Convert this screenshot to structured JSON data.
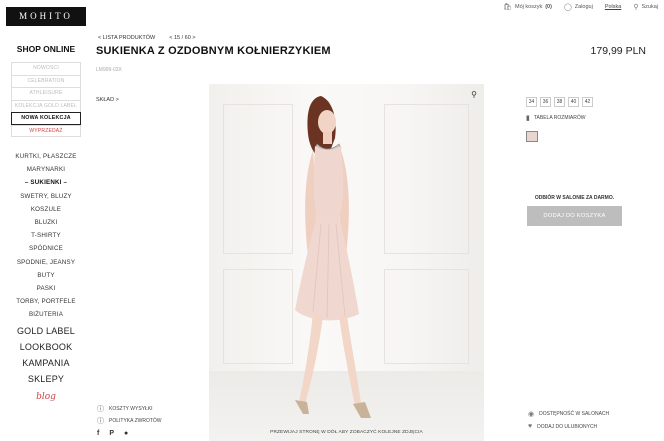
{
  "brand": {
    "logo_text": "MOHITO"
  },
  "topbar": {
    "cart_label": "Mój koszyk",
    "cart_count": "(0)",
    "login_label": "Zaloguj",
    "language": "Polska",
    "search_label": "Szukaj"
  },
  "leftnav": {
    "title": "SHOP ONLINE",
    "box_items": [
      "NOWOSCI",
      "CELEBRATION",
      "ATHLEISURE",
      "KOLEKCJA GOLD LABEL",
      "NOWA KOLEKCJA",
      "WYPRZEDAŻ"
    ],
    "categories": [
      "KURTKI, PŁASZCZE",
      "MARYNARKI",
      "– SUKIENKI –",
      "SWETRY, BLUZY",
      "KOSZULE",
      "BLUZKI",
      "T-SHIRTY",
      "SPÓDNICE",
      "SPODNIE, JEANSY",
      "BUTY",
      "PASKI",
      "TORBY, PORTFELE",
      "BIŻUTERIA"
    ],
    "big_links": [
      "GOLD LABEL",
      "LOOKBOOK",
      "KAMPANIA",
      "SKLEPY"
    ],
    "blog_label": "blog"
  },
  "product": {
    "back_label": "< LISTA PRODUKTÓW",
    "pager": "< 15 / 60 >",
    "title": "SUKIENKA Z OZDOBNYM KOŁNIERZYKIEM",
    "sku": "LM999-03X",
    "price": "179,99 PLN",
    "composition_label": "SKŁAD >",
    "image_caption": "PRZEWIJAJ STRONĘ W DÓŁ ABY ZOBACZYĆ KOLEJNE ZDJĘCIA"
  },
  "options": {
    "sizes": [
      "34",
      "36",
      "38",
      "40",
      "42"
    ],
    "size_chart_label": "TABELA ROZMIARÓW",
    "swatch_color": "#e8d5cf"
  },
  "purchase": {
    "pickup_label": "ODBIÓR W SALONIE ZA DARMO.",
    "add_to_cart_label": "DODAJ DO KOSZYKA",
    "availability_label": "DOSTĘPNOŚĆ W SALONACH",
    "wishlist_label": "DODAJ DO ULUBIONYCH"
  },
  "info": {
    "shipping_label": "KOSZTY WYSYŁKI",
    "returns_label": "POLITYKA ZWROTÓW"
  },
  "icons": {
    "facebook": "f",
    "pinterest": "P",
    "other": "●"
  }
}
